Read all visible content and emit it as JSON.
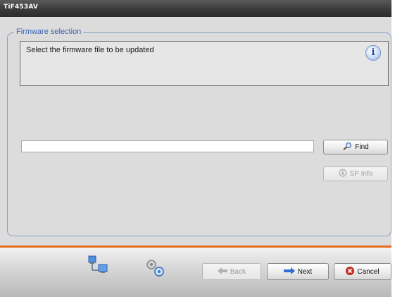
{
  "window": {
    "title": "TiF453AV"
  },
  "group": {
    "title": "Firmware selection"
  },
  "info": {
    "text": "Select the firmware file to be updated",
    "icon": "info-icon",
    "icon_glyph": "i"
  },
  "file": {
    "value": "",
    "placeholder": ""
  },
  "buttons": {
    "find": "Find",
    "sp_info": "SP Info",
    "back": "Back",
    "next": "Next",
    "cancel": "Cancel"
  },
  "colors": {
    "accent_separator": "#e86c1c",
    "group_title": "#3a64b4",
    "titlebar": "#3a3a3a"
  },
  "icons": {
    "find": "search-icon",
    "sp_info": "sp-info-icon",
    "back": "arrow-left-icon",
    "next": "arrow-right-icon",
    "cancel": "cancel-icon",
    "network": "network-icon",
    "settings": "gear-icon"
  }
}
